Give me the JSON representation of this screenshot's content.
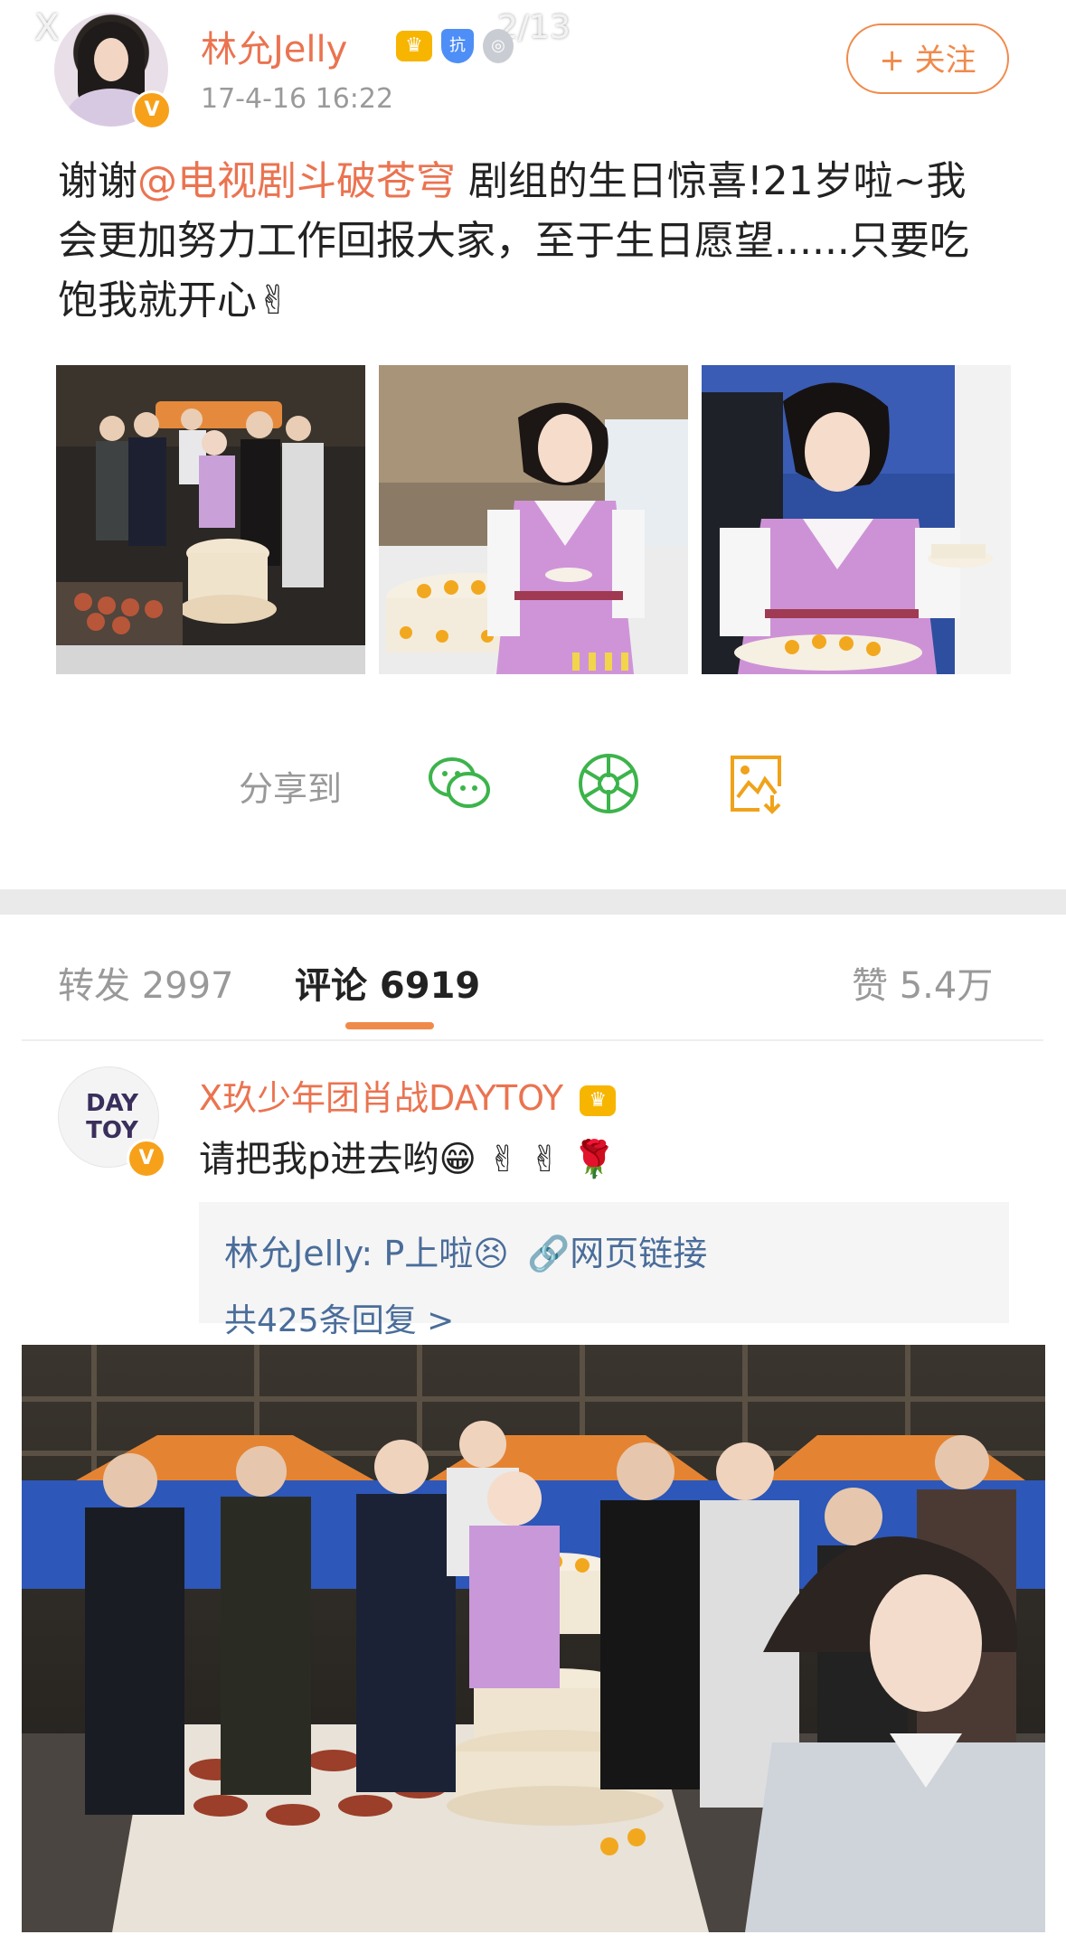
{
  "header": {
    "overlay_close": "X",
    "overlay_page": "2/13",
    "username": "林允Jelly",
    "timestamp": "17-4-16 16:22",
    "follow_label": "+ 关注",
    "verified_mark": "V",
    "badges": {
      "crown": "♛",
      "shield": "抗",
      "medal": "◎"
    }
  },
  "post": {
    "text_before": "谢谢",
    "mention": "@电视剧斗破苍穹",
    "text_after": " 剧组的生日惊喜!21岁啦~我会更加努力工作回报大家，至于生日愿望......只要吃饱我就开心✌",
    "thumbnail_count": 3
  },
  "share": {
    "label": "分享到",
    "icons": [
      "wechat-icon",
      "moments-icon",
      "save-image-icon"
    ]
  },
  "tabs": {
    "repost": "转发 2997",
    "comments": "评论 6919",
    "likes": "赞 5.4万"
  },
  "comment": {
    "avatar_text": "DAY TOY",
    "username": "X玖少年团肖战DAYTOY",
    "text": "请把我p进去哟😁 ✌ ✌ 🌹",
    "reply_author": "林允Jelly:",
    "reply_text": " P上啦😣",
    "reply_link": "网页链接",
    "reply_count": "共425条回复 >"
  },
  "colors": {
    "accent": "#eb7350",
    "button": "#f08a4b",
    "link": "#4a6d9a",
    "share_green": "#3cb44b",
    "share_orange": "#f0a21a"
  }
}
